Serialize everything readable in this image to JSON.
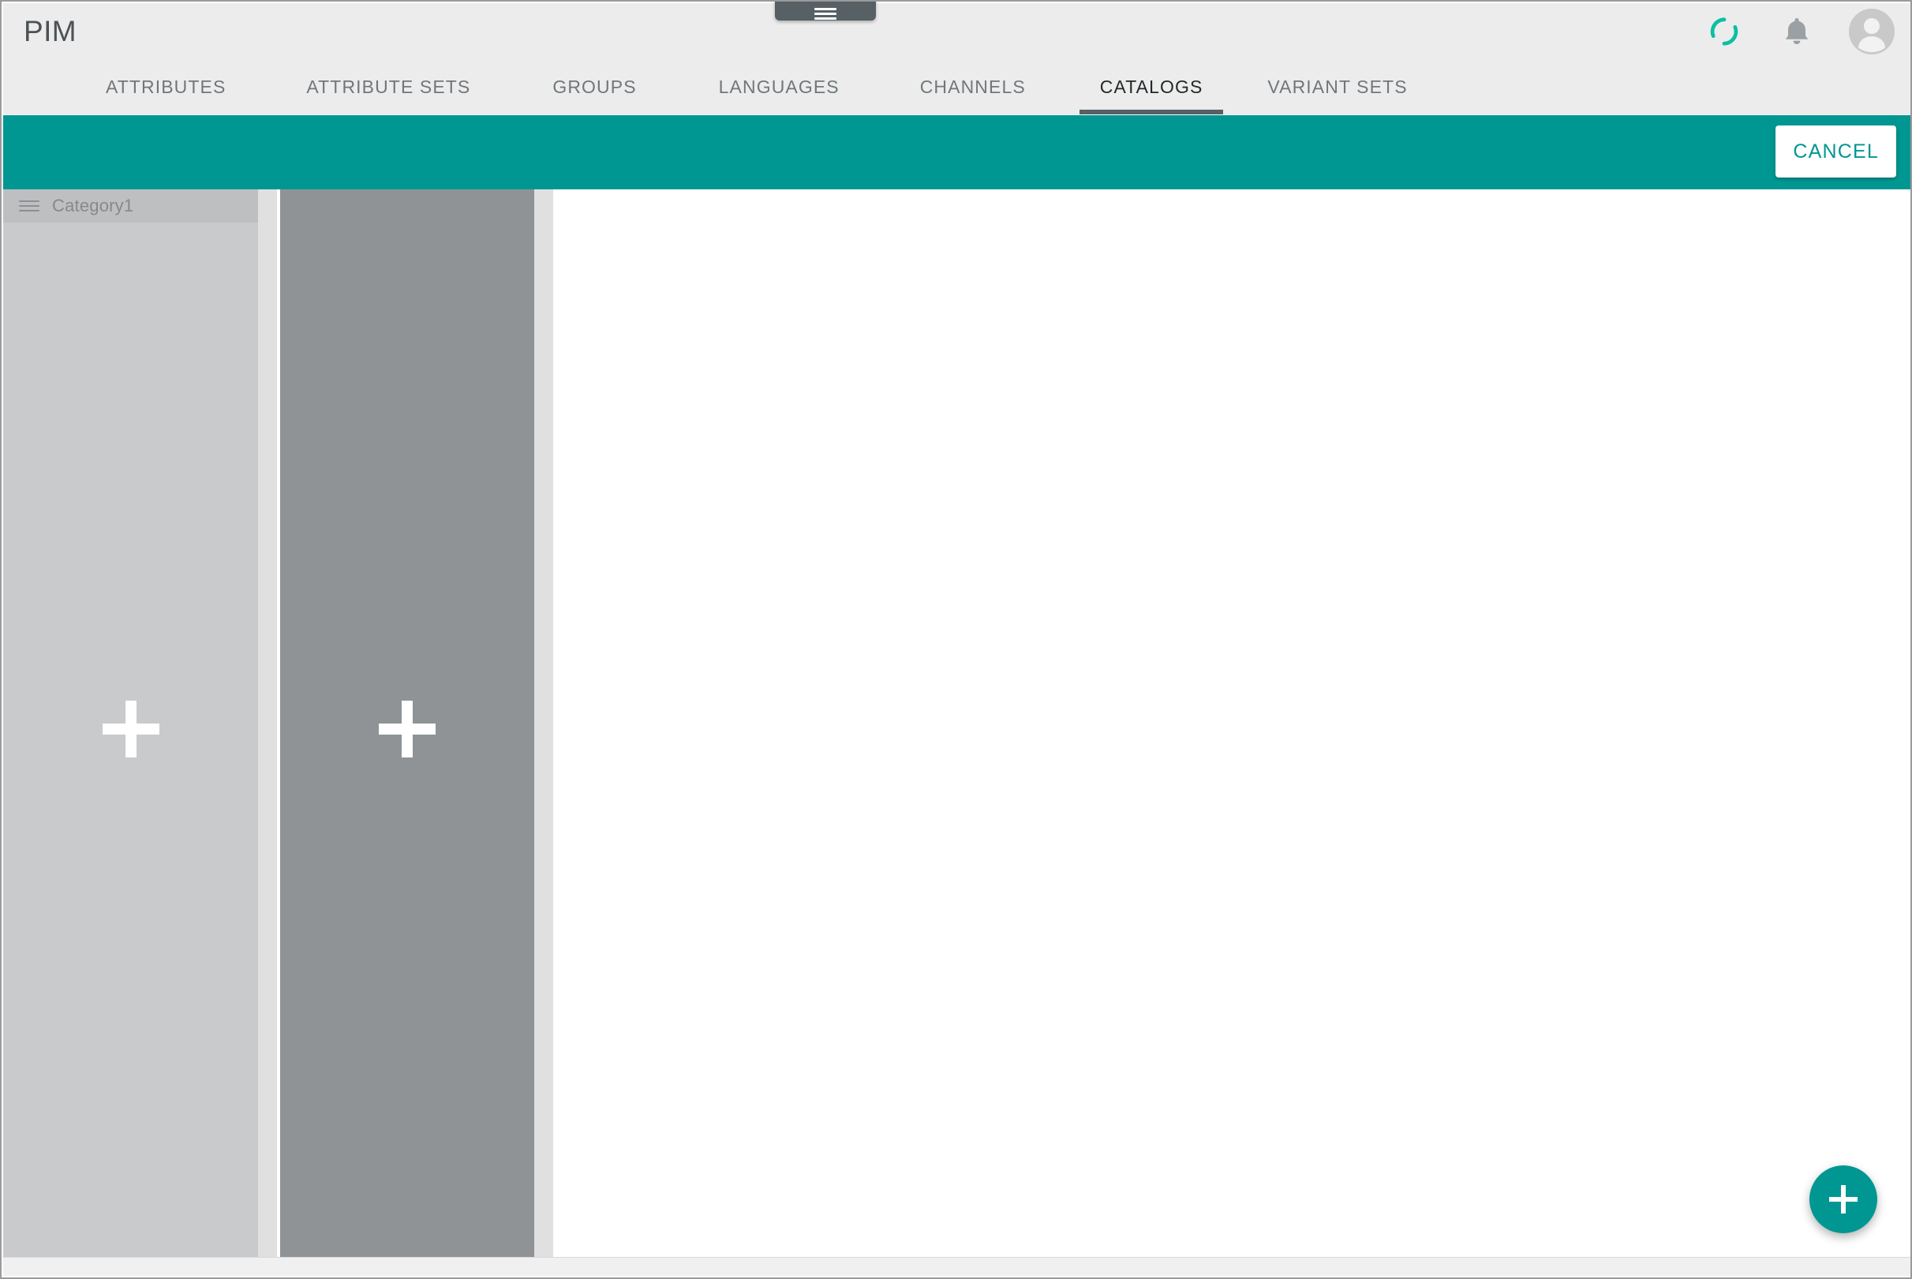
{
  "app": {
    "title": "PIM"
  },
  "header": {
    "drawer_handle_icon": "hamburger-menu-icon",
    "actions": [
      {
        "icon": "loading-spinner-icon",
        "color": "#0bbfa4"
      },
      {
        "icon": "bell-notification-icon",
        "color": "#9aa0a4"
      },
      {
        "icon": "user-avatar-icon",
        "color": "#c9c9c9"
      }
    ]
  },
  "nav": {
    "tabs": [
      {
        "label": "ATTRIBUTES",
        "active": false
      },
      {
        "label": "ATTRIBUTE SETS",
        "active": false
      },
      {
        "label": "GROUPS",
        "active": false
      },
      {
        "label": "LANGUAGES",
        "active": false
      },
      {
        "label": "CHANNELS",
        "active": false
      },
      {
        "label": "CATALOGS",
        "active": true
      },
      {
        "label": "VARIANT SETS",
        "active": false
      }
    ],
    "active_tab": "CATALOGS"
  },
  "action_bar": {
    "background_color": "#009792",
    "cancel_label": "CANCEL"
  },
  "workspace": {
    "columns": [
      {
        "name": "category-column-1",
        "background_color": "#c8cacb",
        "items": [
          {
            "label": "Category1",
            "handle_icon": "drag-handle-icon"
          }
        ],
        "add_icon": "plus-icon"
      },
      {
        "name": "category-column-2",
        "background_color": "#8f9396",
        "items": [],
        "add_icon": "plus-icon"
      }
    ]
  },
  "fab": {
    "icon": "plus-icon",
    "color": "#009792"
  }
}
